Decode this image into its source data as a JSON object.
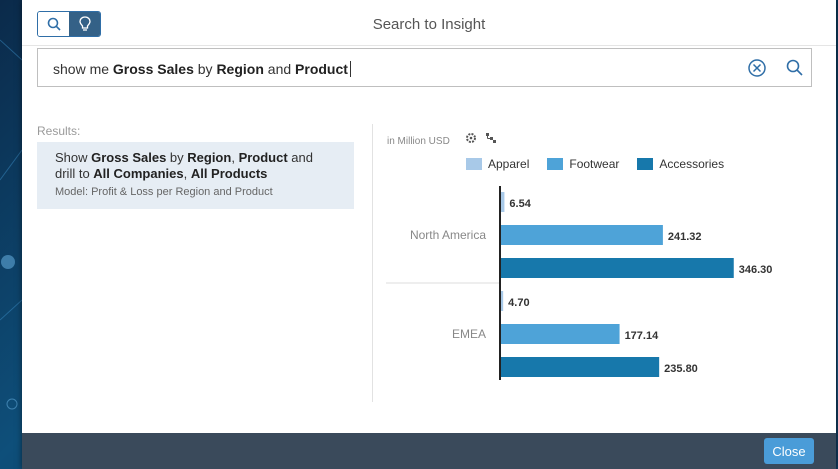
{
  "dialog": {
    "title": "Search to Insight",
    "close_label": "Close"
  },
  "search": {
    "query_parts": [
      {
        "text": "show me ",
        "bold": false
      },
      {
        "text": "Gross Sales",
        "bold": true
      },
      {
        "text": " by ",
        "bold": false
      },
      {
        "text": "Region",
        "bold": true
      },
      {
        "text": " and ",
        "bold": false
      },
      {
        "text": "Product",
        "bold": true
      }
    ]
  },
  "results": {
    "label": "Results:",
    "items": [
      {
        "line_parts": [
          {
            "text": "Show ",
            "bold": false
          },
          {
            "text": "Gross Sales",
            "bold": true
          },
          {
            "text": " by ",
            "bold": false
          },
          {
            "text": "Region",
            "bold": true
          },
          {
            "text": ", ",
            "bold": false
          },
          {
            "text": "Product",
            "bold": true
          },
          {
            "text": " and drill to ",
            "bold": false
          },
          {
            "text": "All Companies",
            "bold": true
          },
          {
            "text": ", ",
            "bold": false
          },
          {
            "text": "All Products",
            "bold": true
          }
        ],
        "model": "Model: Profit & Loss per Region and Product"
      }
    ]
  },
  "chart_data": {
    "type": "bar",
    "orientation": "horizontal",
    "unit": "in Million USD",
    "categories": [
      "North America",
      "EMEA"
    ],
    "series": [
      {
        "name": "Apparel",
        "color": "#a8c9e8",
        "values": [
          6.54,
          4.7
        ]
      },
      {
        "name": "Footwear",
        "color": "#4ea3d8",
        "values": [
          241.32,
          177.14
        ]
      },
      {
        "name": "Accessories",
        "color": "#1778ab",
        "values": [
          346.3,
          235.8
        ]
      }
    ],
    "legend_position": "top"
  }
}
